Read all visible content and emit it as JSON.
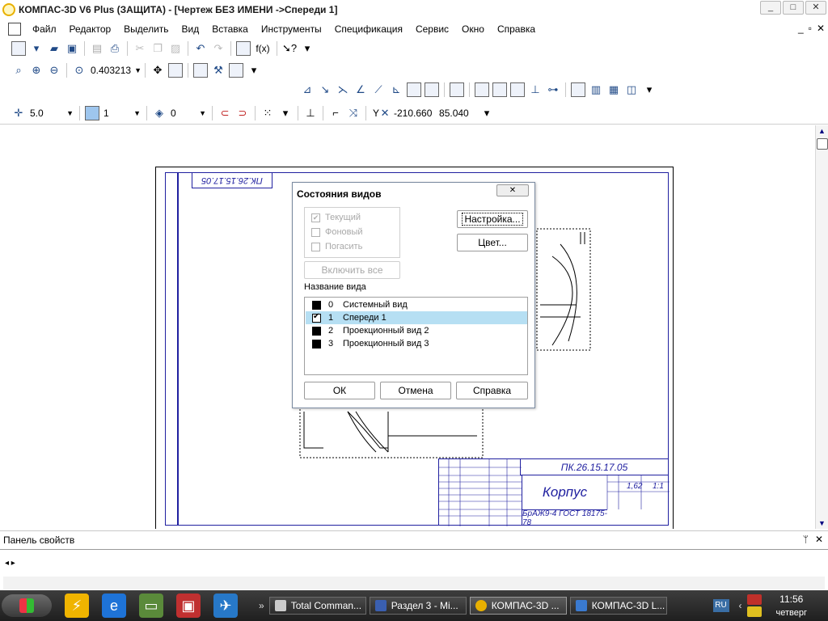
{
  "window": {
    "title": "КОМПАС-3D V6 Plus (ЗАЩИТА) - [Чертеж БЕЗ ИМЕНИ ->Спереди 1]",
    "buttons": [
      "_",
      "□",
      "✕"
    ]
  },
  "menu": {
    "items": [
      "Файл",
      "Редактор",
      "Выделить",
      "Вид",
      "Вставка",
      "Инструменты",
      "Спецификация",
      "Сервис",
      "Окно",
      "Справка"
    ],
    "mdi_buttons": [
      "_",
      "▫",
      "✕"
    ]
  },
  "toolbar2": {
    "zoom_value": "0.403213",
    "fx_label": "f(x)"
  },
  "toolbar4": {
    "step_value": "5.0",
    "layer_value": "1",
    "style_value": "0",
    "coord_label": "Y",
    "coord_x": "-210.660",
    "coord_y": "85.040"
  },
  "drawing": {
    "stamp_top": "ПК.26.15.17.05",
    "code": "ПК.26.15.17.05",
    "part_name": "Корпус",
    "material": "БрАЖ9-4  ГОСТ 18175-78",
    "mass": "1,62",
    "scale": "1:1"
  },
  "dialog": {
    "title": "Состояния видов",
    "close": "✕",
    "checkboxes": [
      "Текущий",
      "Фоновый",
      "Погасить"
    ],
    "settings_button": "Настройка...",
    "color_button": "Цвет...",
    "enable_all_button": "Включить все",
    "list_label": "Название вида",
    "views": [
      {
        "num": "0",
        "name": "Системный вид"
      },
      {
        "num": "1",
        "name": "Спереди 1"
      },
      {
        "num": "2",
        "name": "Проекционный вид 2"
      },
      {
        "num": "3",
        "name": "Проекционный вид 3"
      }
    ],
    "ok_button": "ОК",
    "cancel_button": "Отмена",
    "help_button": "Справка"
  },
  "properties_panel": {
    "title": "Панель свойств",
    "pin": "ᛘ",
    "close": "✕",
    "nav": "◂ ▸"
  },
  "taskbar": {
    "tasks": [
      "Total Comman...",
      "Раздел 3 - Mi...",
      "КОМПАС-3D ...",
      "КОМПАС-3D L..."
    ],
    "language": "RU",
    "time": "11:56",
    "day": "четверг"
  }
}
